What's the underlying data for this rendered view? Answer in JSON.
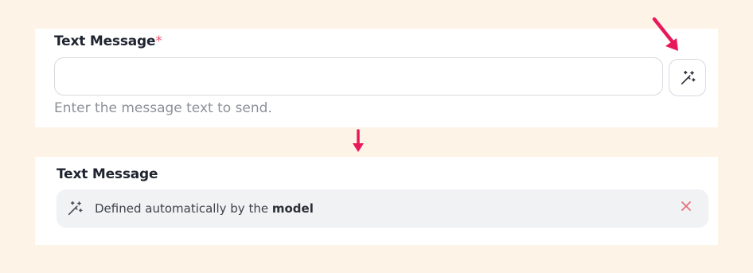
{
  "top_field": {
    "label": "Text Message",
    "required_mark": "*",
    "input_value": "",
    "helper_text": "Enter the message text to send."
  },
  "bottom_field": {
    "label": "Text Message",
    "auto_prefix": "Defined automatically by the ",
    "auto_bold": "model"
  },
  "icons": {
    "magic": "magic-wand-icon",
    "close": "close-icon",
    "annotation_arrows": "arrow-icon"
  },
  "colors": {
    "page_bg": "#fdf3e7",
    "card_bg": "#ffffff",
    "required": "#f0506e",
    "annotation_arrow": "#e8195a",
    "close": "#e5707f",
    "auto_bg": "#f1f2f4"
  }
}
